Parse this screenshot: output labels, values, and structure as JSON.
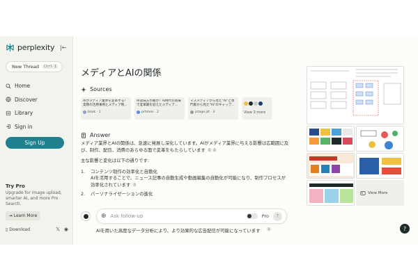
{
  "app": {
    "name": "perplexity"
  },
  "sidebar": {
    "new_thread": "New Thread",
    "shortcut": "Ctrl I",
    "items": [
      {
        "label": "Home",
        "icon": "search-icon"
      },
      {
        "label": "Discover",
        "icon": "globe-icon"
      },
      {
        "label": "Library",
        "icon": "library-icon"
      },
      {
        "label": "Sign in",
        "icon": "signin-icon"
      }
    ],
    "signup": "Sign Up",
    "try_pro_title": "Try Pro",
    "try_pro_desc": "Upgrade for image upload, smarter AI, and more Pro Search.",
    "learn_more": "Learn More",
    "download": "Download"
  },
  "main": {
    "title": "メディアとAIの関係",
    "sources_heading": "Sources",
    "sources": [
      {
        "title": "AIがメディア業界を変革する！実際の活用事例とメディア制...",
        "site": "book · 1"
      },
      {
        "title": "AIは味方か敵か？AI時代の到来で変革期を迎えたメディア...",
        "site": "prtimes · 2"
      },
      {
        "title": "マスメディアから見た\"AI\"と専門家から見た\"AI\"のギャップ...",
        "site": "jstage.jst · 3"
      }
    ],
    "view_more_sources": "View 3 more",
    "answer_heading": "Answer",
    "answer_intro": "メディア業界とAIの関係は、急速に発展し深化しています。AIがメディア業界に与える影響は広範囲に及び、制作、配信、消費のあらゆる面で変革をもたらしています",
    "intro_cites": [
      "1",
      "2"
    ],
    "changes_intro": "主な影響と変化は以下の通りです:",
    "list": [
      {
        "num": "1.",
        "title": "コンテンツ制作の効率化と自動化",
        "desc": "AIを活用することで、ニュース記事の自動生成や動画編集の自動化が可能になり、制作プロセスが効率化されています",
        "cite": "1"
      },
      {
        "num": "2.",
        "title": "パーソナライゼーションの進化",
        "desc": "",
        "cite": ""
      }
    ],
    "after_follow": "AIを用いた高度なデータ分析により、より効果的な広告配信が可能になっています",
    "after_cite": "3",
    "view_more_images": "View More"
  },
  "followup": {
    "placeholder": "Ask follow-up",
    "pro": "Pro"
  },
  "colors": {
    "accent": "#20808d",
    "sidebar_bg": "#f3f3ee",
    "main_bg": "#fcfcf9"
  }
}
